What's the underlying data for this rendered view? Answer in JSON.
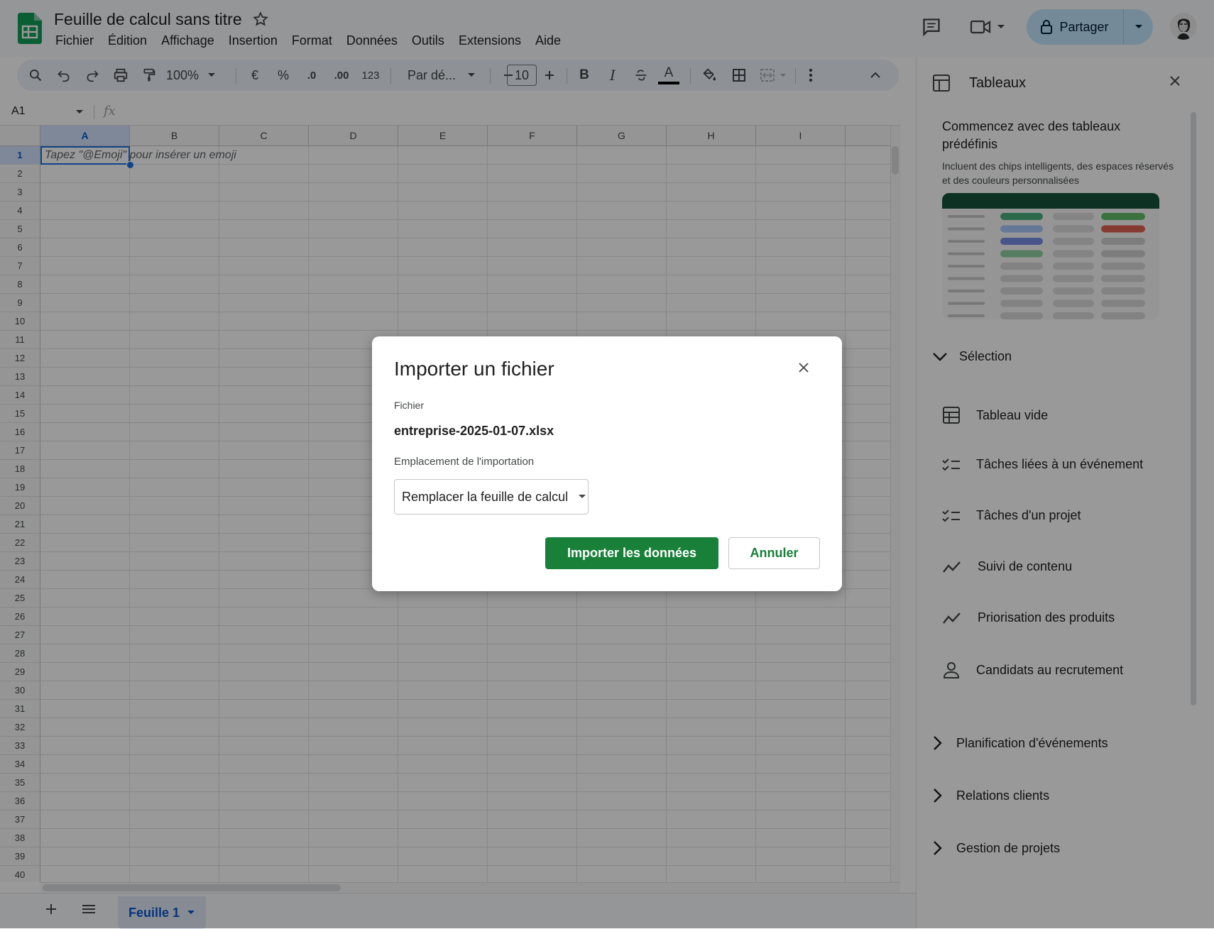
{
  "app": {
    "title": "Feuille de calcul sans titre",
    "menu": [
      "Fichier",
      "Édition",
      "Affichage",
      "Insertion",
      "Format",
      "Données",
      "Outils",
      "Extensions",
      "Aide"
    ],
    "share_label": "Partager"
  },
  "toolbar": {
    "zoom": "100%",
    "currency": "€",
    "percent": "%",
    "dec_decrease": ".0",
    "dec_increase": ".00",
    "number_format": "123",
    "font": "Par dé...",
    "font_size": "10",
    "bold": "B",
    "italic": "I",
    "text_color": "A"
  },
  "formula_bar": {
    "cell_ref": "A1",
    "fx": "fx"
  },
  "grid": {
    "columns": [
      "A",
      "B",
      "C",
      "D",
      "E",
      "F",
      "G",
      "H",
      "I"
    ],
    "selected_column": "A",
    "row_count": 40,
    "selected_row": 1,
    "a1_hint": "Tapez \"@Emoji\" pour insérer un emoji"
  },
  "sheets": {
    "active": "Feuille 1"
  },
  "panel": {
    "title": "Tableaux",
    "promo_title": "Commencez avec des tableaux prédéfinis",
    "promo_desc": "Incluent des chips intelligents, des espaces réservés et des couleurs personnalisées",
    "selection_label": "Sélection",
    "templates": [
      {
        "label": "Tableau vide",
        "icon": "table-icon"
      },
      {
        "label": "Tâches liées à un événement",
        "icon": "checklist-icon"
      },
      {
        "label": "Tâches d'un projet",
        "icon": "checklist-icon"
      },
      {
        "label": "Suivi de contenu",
        "icon": "trend-icon"
      },
      {
        "label": "Priorisation des produits",
        "icon": "trend-icon"
      },
      {
        "label": "Candidats au recrutement",
        "icon": "person-icon"
      }
    ],
    "sections": [
      "Planification d'événements",
      "Relations clients",
      "Gestion de projets"
    ]
  },
  "dialog": {
    "title": "Importer un fichier",
    "file_label": "Fichier",
    "file_name": "entreprise-2025-01-07.xlsx",
    "location_label": "Emplacement de l'importation",
    "location_value": "Remplacer la feuille de calcul",
    "import_button": "Importer les données",
    "cancel_button": "Annuler"
  },
  "colors": {
    "primary_green": "#188038",
    "accent_blue": "#0b57d0",
    "share_bg": "#c2e7ff"
  }
}
